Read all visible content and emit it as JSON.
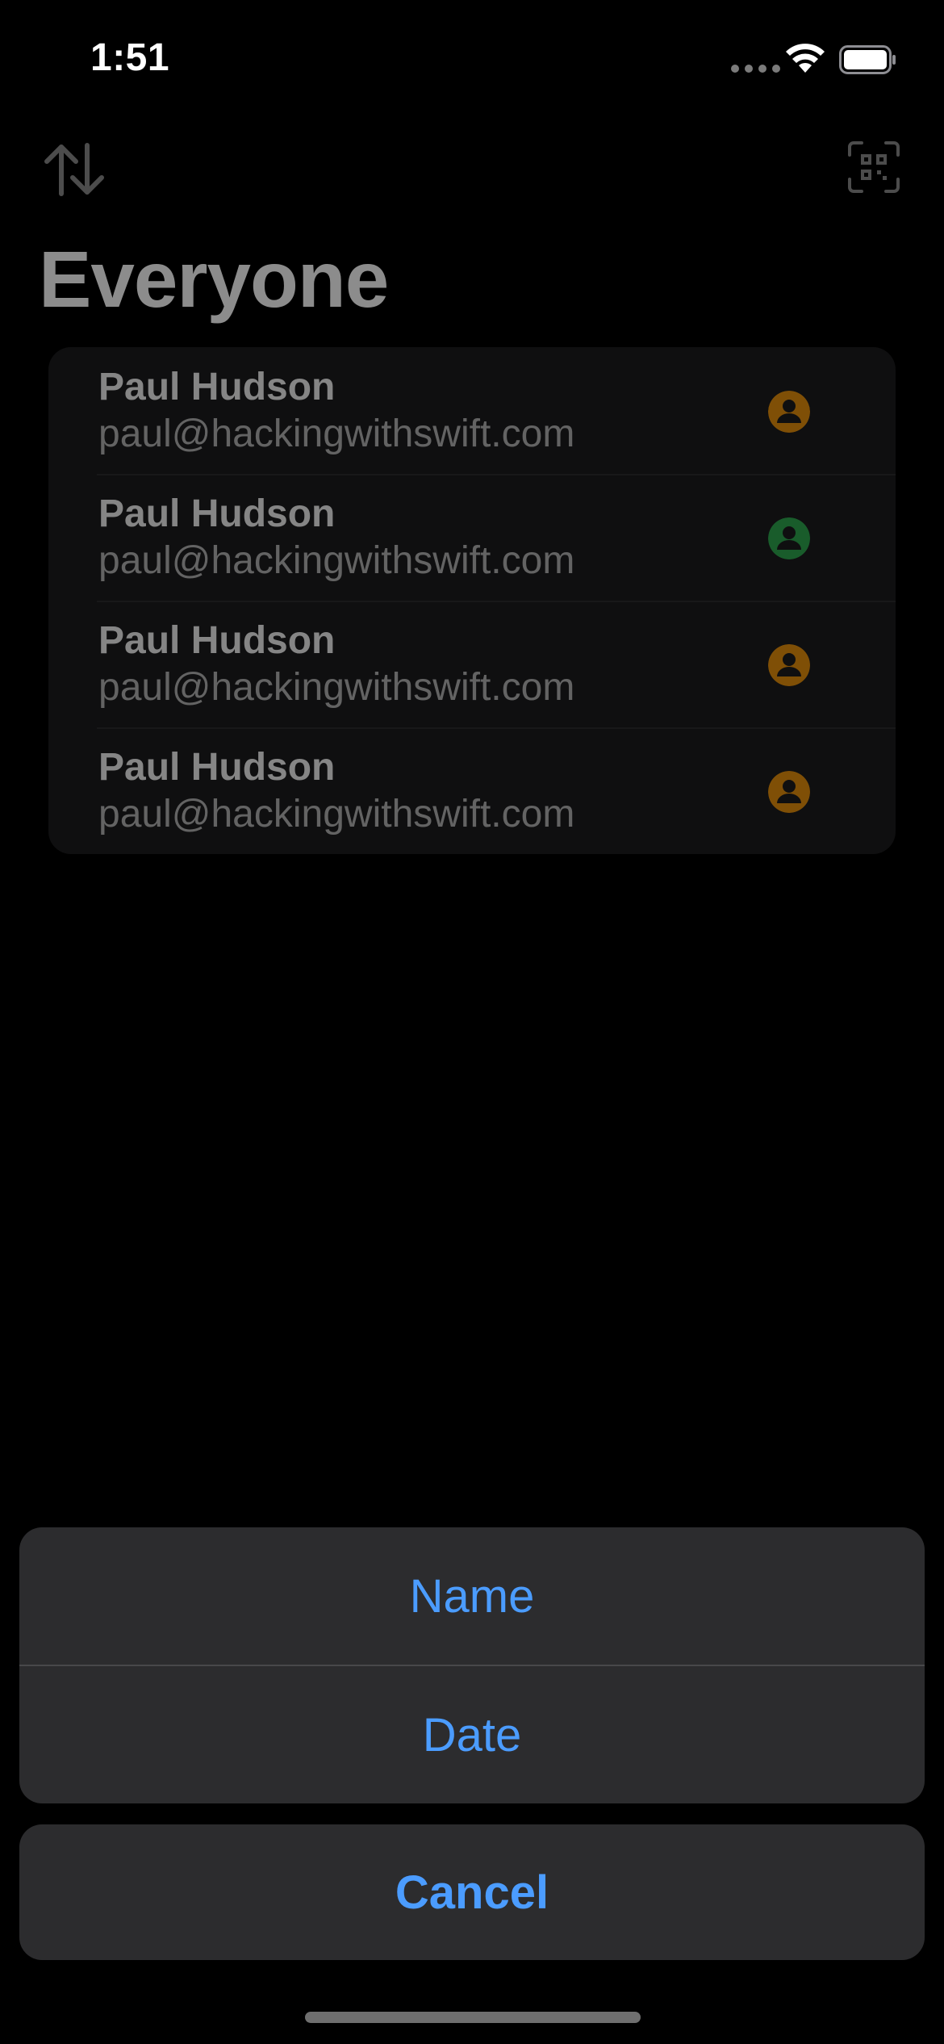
{
  "status_bar": {
    "time": "1:51"
  },
  "nav": {
    "sort_icon": "arrow-up-arrow-down-icon",
    "scan_icon": "qr-code-scanner-icon"
  },
  "page": {
    "title": "Everyone"
  },
  "contacts": [
    {
      "name": "Paul Hudson",
      "email": "paul@hackingwithswift.com",
      "status_color": "#e8900c"
    },
    {
      "name": "Paul Hudson",
      "email": "paul@hackingwithswift.com",
      "status_color": "#2fa84f"
    },
    {
      "name": "Paul Hudson",
      "email": "paul@hackingwithswift.com",
      "status_color": "#e8900c"
    },
    {
      "name": "Paul Hudson",
      "email": "paul@hackingwithswift.com",
      "status_color": "#e8900c"
    }
  ],
  "action_sheet": {
    "options": [
      {
        "label": "Name"
      },
      {
        "label": "Date"
      }
    ],
    "cancel_label": "Cancel"
  },
  "colors": {
    "accent": "#4b9cff",
    "background": "#000000",
    "sheet_background": "#2c2c2e"
  }
}
